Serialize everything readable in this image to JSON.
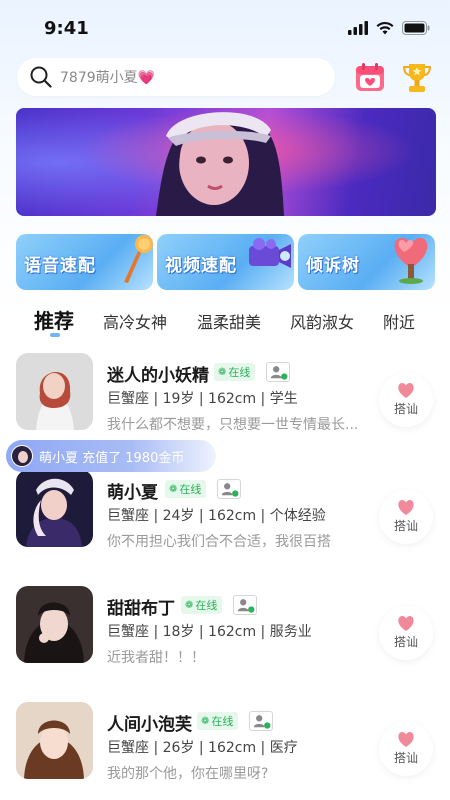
{
  "status_bar": {
    "time": "9:41"
  },
  "search": {
    "placeholder": "7879萌小夏💗"
  },
  "features": [
    {
      "label": "语音速配"
    },
    {
      "label": "视频速配"
    },
    {
      "label": "倾诉树"
    }
  ],
  "tabs": [
    {
      "label": "推荐",
      "active": true
    },
    {
      "label": "高冷女神"
    },
    {
      "label": "温柔甜美"
    },
    {
      "label": "风韵淑女"
    },
    {
      "label": "附近"
    }
  ],
  "users": [
    {
      "name": "迷人的小妖精",
      "online": "在线",
      "info": "巨蟹座 | 19岁 | 162cm | 学生",
      "signature": "我什么都不想要，只想要一世专情最长...",
      "action": "搭讪"
    },
    {
      "name": "萌小夏",
      "online": "在线",
      "info": "巨蟹座 | 24岁 | 162cm | 个体经验",
      "signature": "你不用担心我们合不合适，我很百搭",
      "action": "搭讪"
    },
    {
      "name": "甜甜布丁",
      "online": "在线",
      "info": "巨蟹座 | 18岁 | 162cm | 服务业",
      "signature": "近我者甜！！！",
      "action": "搭讪"
    },
    {
      "name": "人间小泡芙",
      "online": "在线",
      "info": "巨蟹座 | 26岁 | 162cm | 医疗",
      "signature": "我的那个他，你在哪里呀?",
      "action": "搭讪"
    }
  ],
  "toast": {
    "text": "萌小夏 充值了 1980金币"
  },
  "colors": {
    "accent": "#6fb6f2",
    "online_green": "#2bb25a",
    "heart_pink": "#f08a9a"
  }
}
